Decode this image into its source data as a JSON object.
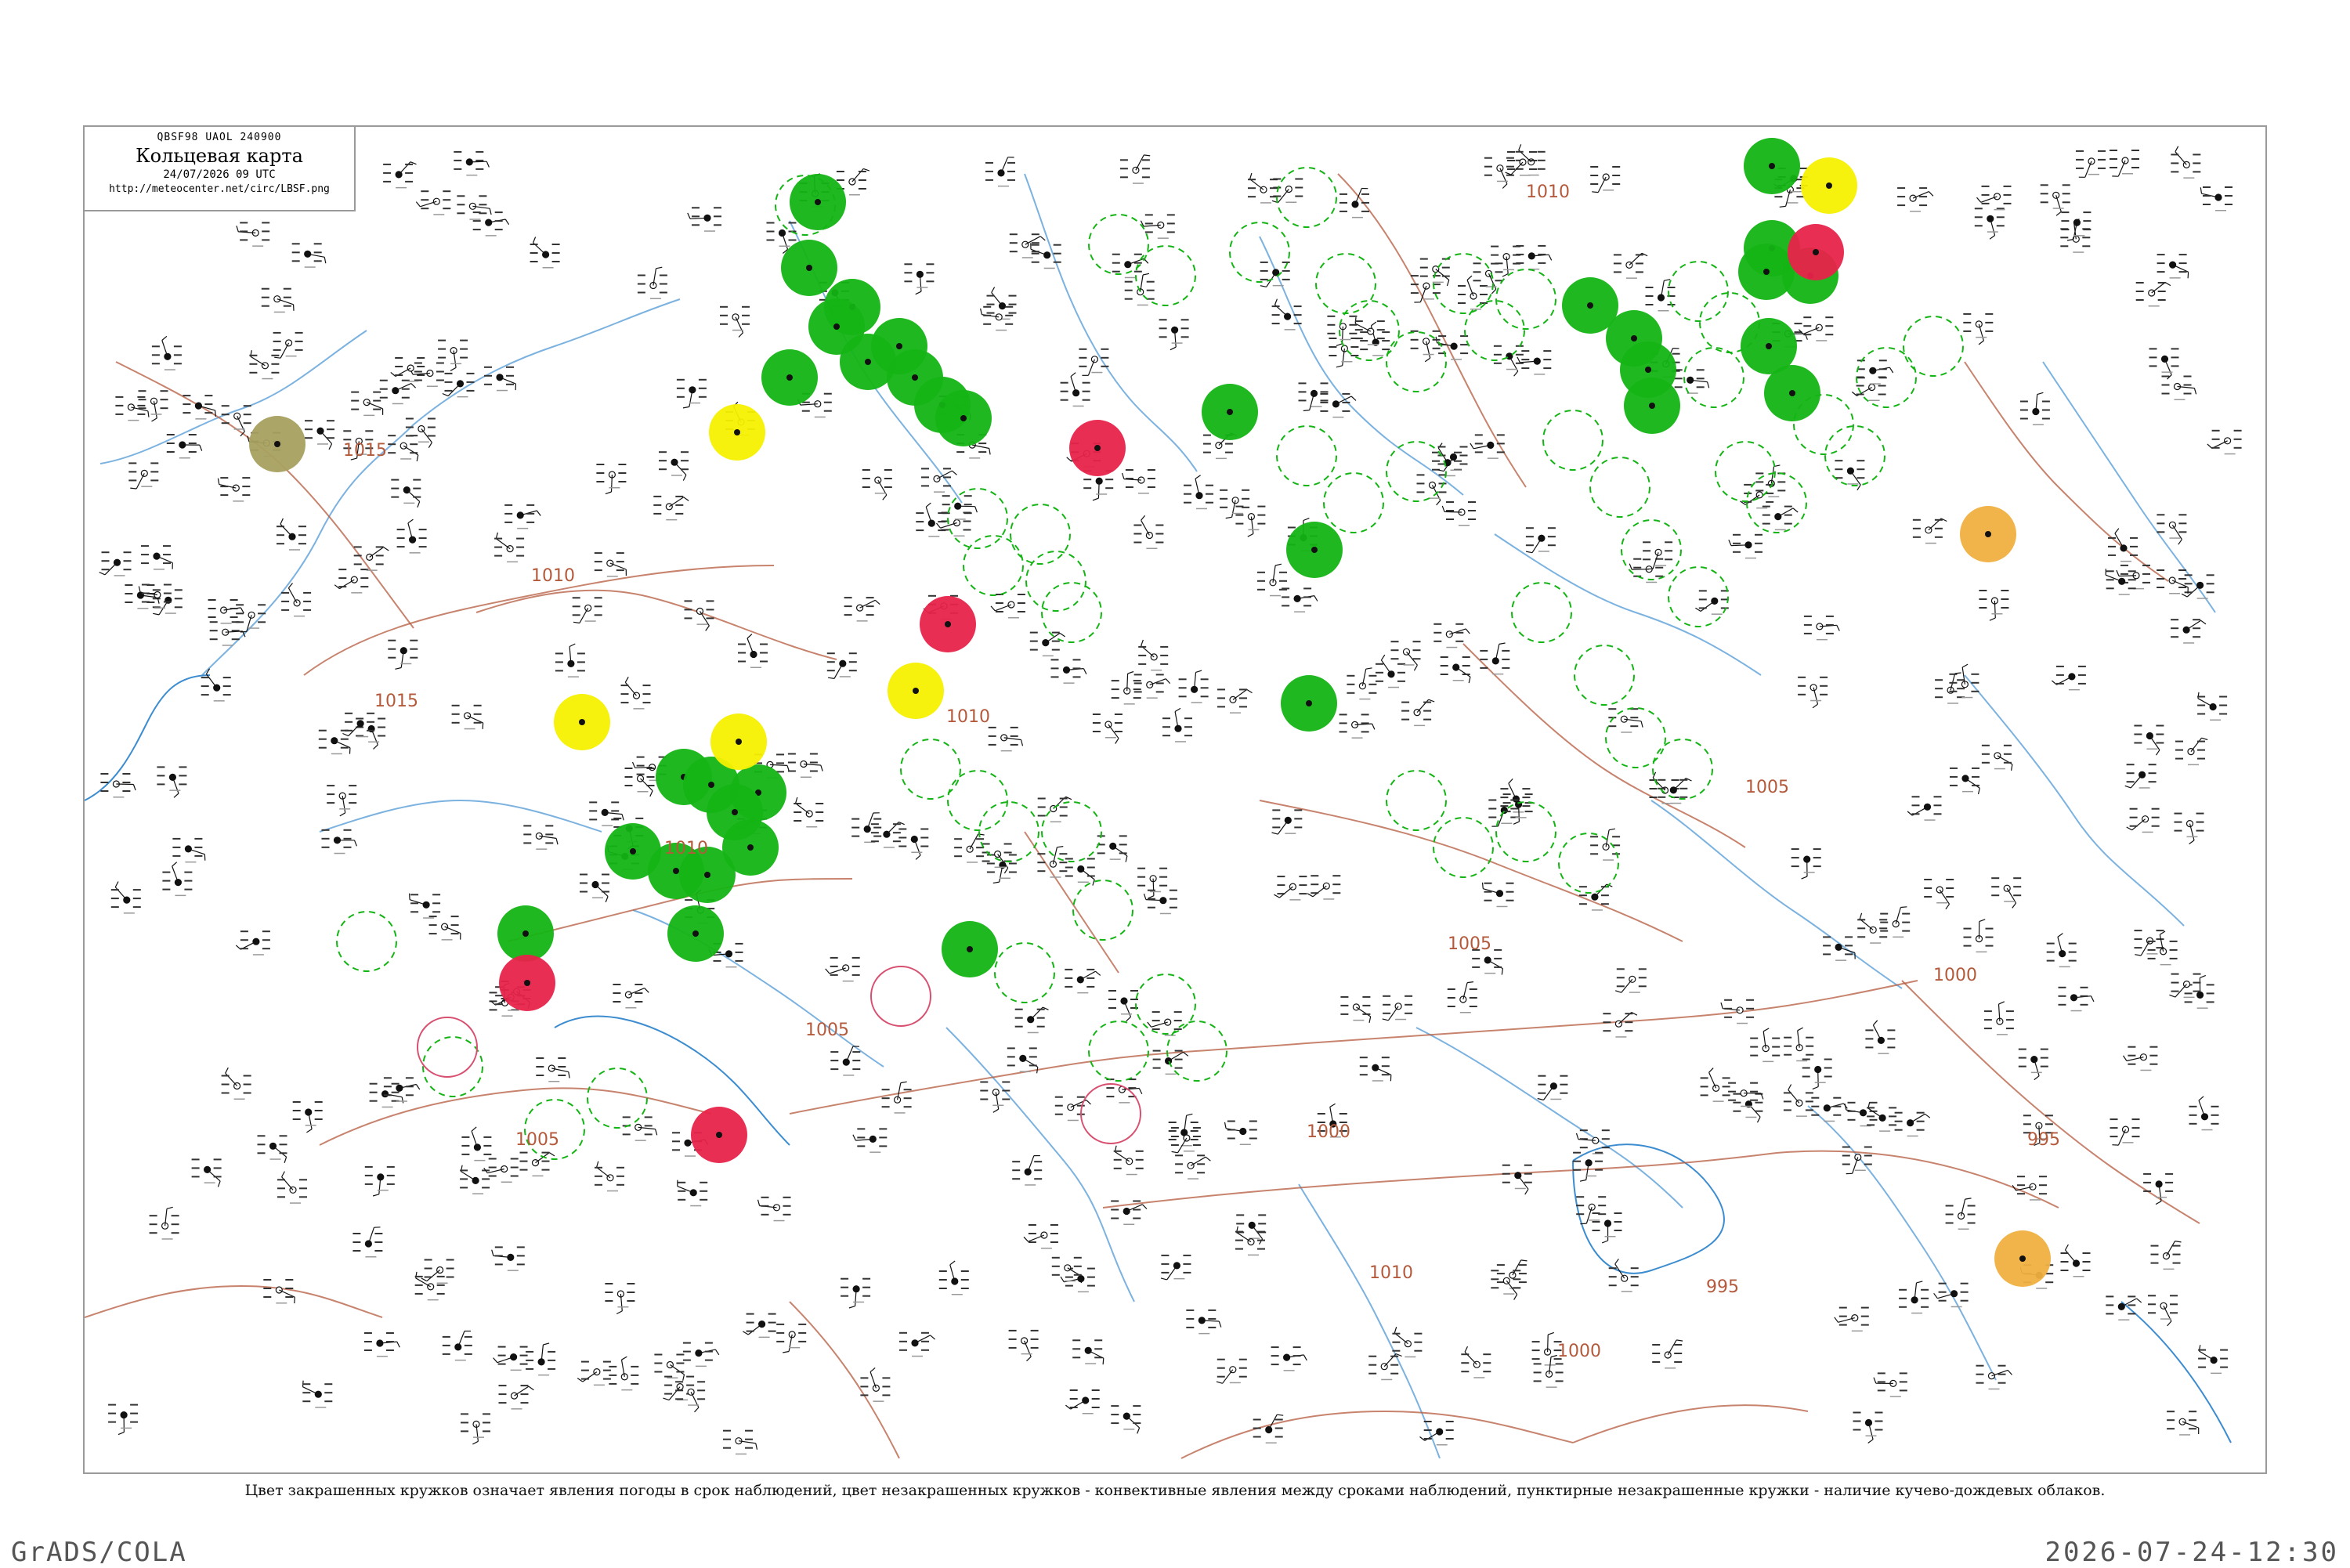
{
  "header": {
    "code_line": "QBSF98  UAOL  240900",
    "title": "Кольцевая карта",
    "datetime": "24/07/2026 09 UTC",
    "url": "http://meteocenter.net/circ/LBSF.png"
  },
  "caption": "Цвет закрашенных кружков означает явления погоды в срок наблюдений, цвет незакрашенных кружков - конвективные явления между сроками наблюдений, пунктирные незакрашенные кружки - наличие кучево-дождевых облаков.",
  "footer": {
    "left": "GrADS/COLA",
    "right": "2026-07-24-12:30"
  },
  "isobar_labels": [
    "1015",
    "1015",
    "1010",
    "1010",
    "1010",
    "1005",
    "1005",
    "1005",
    "1000",
    "1000",
    "1000",
    "995",
    "995",
    "1010",
    "1010",
    "1005"
  ],
  "colors": {
    "rain": "#14b414",
    "thunderstorm": "#e8234a",
    "fog_haze": "#f5f000",
    "dust": "#a8a060",
    "orange": "#f0b040",
    "cb_dashed": "#14b414",
    "isobar": "#b45a3c",
    "river": "#5a9fd8",
    "coast": "#3c8cd0"
  },
  "legend_symbols": [
    "rain-circle",
    "thunderstorm-circle",
    "fog-circle",
    "dust-circle",
    "cumulonimbus-dashed-circle"
  ]
}
